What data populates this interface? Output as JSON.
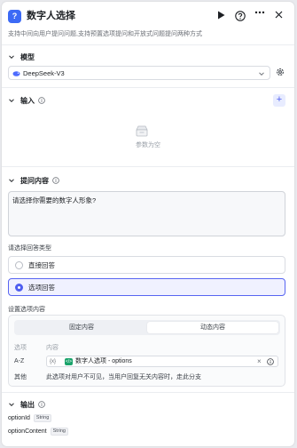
{
  "header": {
    "node_icon": "question-icon",
    "title": "数字人选择",
    "subtitle": "支持中间向用户提问问题,支持预置选项提问和开放式问题提问两种方式",
    "actions": [
      "play-icon",
      "help-icon",
      "more-icon",
      "close-icon"
    ]
  },
  "model": {
    "section_title": "模型",
    "selected_model": "DeepSeek-V3"
  },
  "inputs": {
    "section_title": "输入",
    "add_button": "+",
    "empty_text": "参数为空"
  },
  "question": {
    "section_title": "提问内容",
    "prompt_text": "请选择你需要的数字人形象?"
  },
  "answer_type": {
    "label": "请选择回答类型",
    "options": [
      {
        "label": "直接回答",
        "selected": false
      },
      {
        "label": "选项回答",
        "selected": true
      }
    ]
  },
  "options_content": {
    "label": "设置选项内容",
    "tabs": [
      {
        "label": "固定内容",
        "active": false
      },
      {
        "label": "动态内容",
        "active": true
      }
    ],
    "col_option": "选项",
    "col_content": "内容",
    "row_key": "A-Z",
    "ref_icon_text": "{x}",
    "var_tag": "</>",
    "var_text": "数字人选项 - options",
    "other_key": "其他",
    "other_text": "此选项对用户不可见，当用户回复无关内容时，走此分支"
  },
  "output": {
    "section_title": "输出",
    "fields": [
      {
        "name": "optionId",
        "type": "String"
      },
      {
        "name": "optionContent",
        "type": "String"
      }
    ]
  },
  "colors": {
    "accent": "#4e5ef0",
    "node_icon_bg": "#3c6af5",
    "var_tag_bg": "#1aa36b"
  }
}
